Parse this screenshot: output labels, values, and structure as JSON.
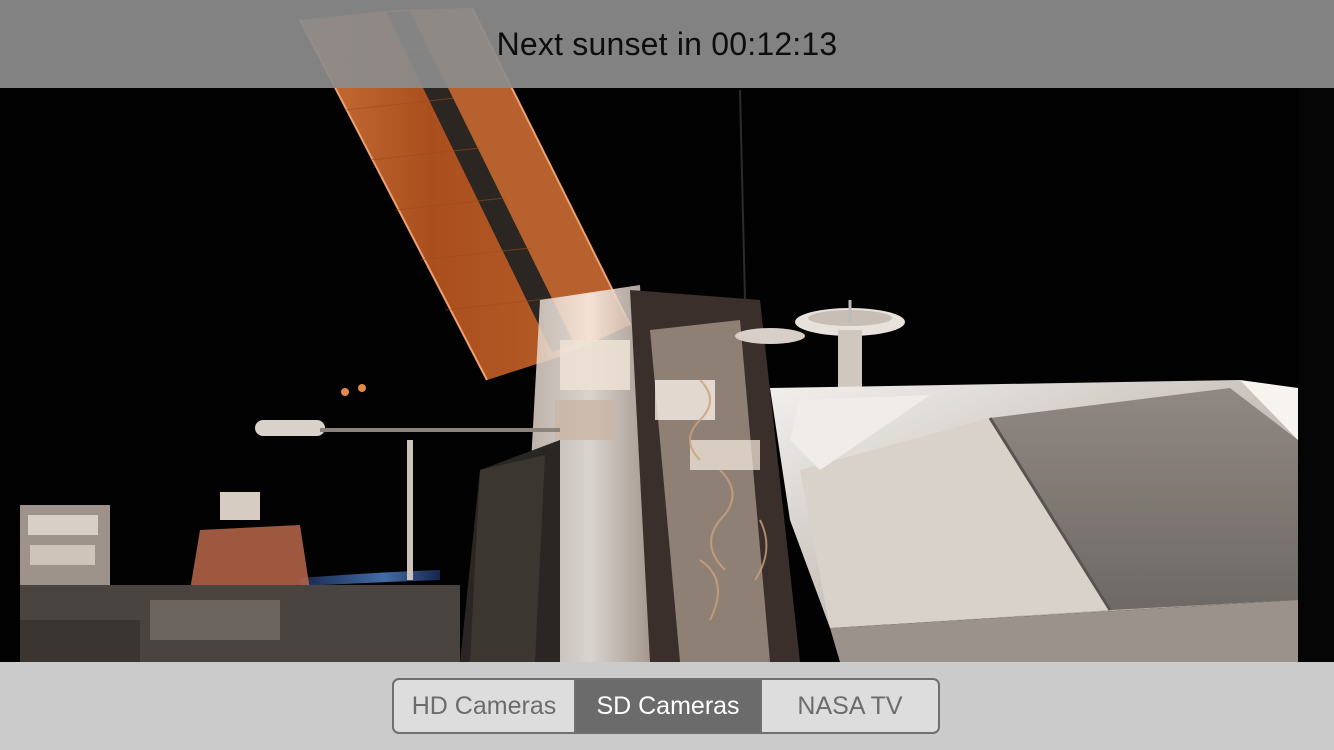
{
  "header": {
    "sunset_countdown": "Next sunset in 00:12:13"
  },
  "camera_selector": {
    "selected": "SD Cameras",
    "options": [
      {
        "label": "HD Cameras",
        "selected": false
      },
      {
        "label": "SD Cameras",
        "selected": true
      },
      {
        "label": "NASA TV",
        "selected": false
      }
    ]
  },
  "colors": {
    "top_bar": "#8c8c8c",
    "bottom_bar": "#ececec",
    "selected_segment": "#6b6b6b",
    "segment_border": "#6f6f6f",
    "solar_panel": "#c8642a"
  }
}
